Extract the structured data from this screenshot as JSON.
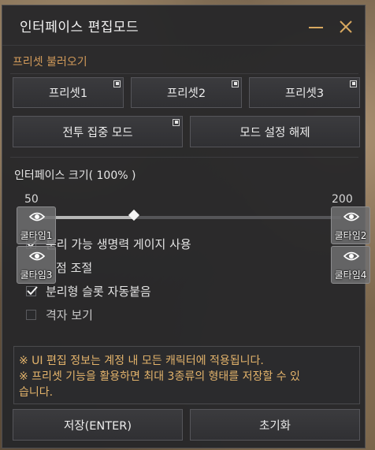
{
  "window": {
    "title": "인터페이스 편집모드"
  },
  "presets": {
    "label": "프리셋 불러오기",
    "buttons": [
      "프리셋1",
      "프리셋2",
      "프리셋3"
    ],
    "combat_focus": "전투 집중 모드",
    "release_mode": "모드 설정 해제"
  },
  "size": {
    "label": "인터페이스 크기( 100% )",
    "min": "50",
    "max": "200",
    "value_percent": 100,
    "slider_fraction": 0.333
  },
  "options": {
    "separable_hp": "분리 가능 생명력 게이지 사용",
    "section2_partial": "점 조절",
    "auto_attach": "분리형 슬롯 자동붙음",
    "grid_view": "격자 보기",
    "separable_hp_checked": true,
    "auto_attach_checked": true,
    "grid_view_checked": false
  },
  "cooldowns": [
    "쿨타임1",
    "쿨타임2",
    "쿨타임3",
    "쿨타임4"
  ],
  "info": {
    "line1": "※ UI 편집 정보는 계정 내 모든 캐릭터에 적용됩니다.",
    "line2": "※ 프리셋 기능을 활용하면 최대 3종류의 형태를 저장할 수 있",
    "line3": "습니다."
  },
  "footer": {
    "save": "저장(ENTER)",
    "reset": "초기화"
  },
  "colors": {
    "accent": "#d19a5a",
    "info_text": "#e3b36b",
    "panel_bg": "#28282a"
  },
  "icons": {
    "minimize": "minimize-icon",
    "close": "close-icon",
    "eye": "eye-icon",
    "corner": "expand-corner-icon"
  }
}
